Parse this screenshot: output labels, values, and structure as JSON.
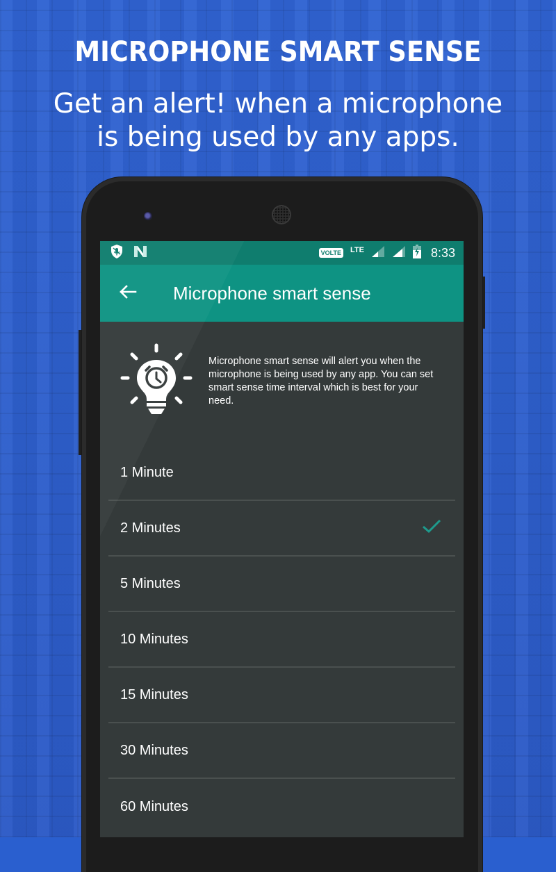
{
  "promo": {
    "title": "MICROPHONE SMART SENSE",
    "subtitle_line1": "Get an alert! when a microphone",
    "subtitle_line2": "is being used by any apps."
  },
  "status_bar": {
    "left_icons": [
      "shield-mic-icon",
      "n-logo-icon"
    ],
    "volte": "VOLTE",
    "network": "LTE",
    "time": "8:33"
  },
  "app_bar": {
    "back_icon": "arrow-left",
    "title": "Microphone smart sense"
  },
  "intro": {
    "icon": "lightbulb-clock-icon",
    "text": "Microphone smart sense will alert you when the microphone is being used by any app. You can set smart sense time interval which is best for your need."
  },
  "intervals": {
    "selected": "2 Minutes",
    "accent_color": "#1e9a8c",
    "items": [
      {
        "label": "1 Minute",
        "checked": false
      },
      {
        "label": "2 Minutes",
        "checked": true
      },
      {
        "label": "5 Minutes",
        "checked": false
      },
      {
        "label": "10 Minutes",
        "checked": false
      },
      {
        "label": "15 Minutes",
        "checked": false
      },
      {
        "label": "30 Minutes",
        "checked": false
      },
      {
        "label": "60 Minutes",
        "checked": false
      }
    ]
  },
  "colors": {
    "status_bar": "#0f7d6e",
    "app_bar": "#0e9383",
    "screen_bg": "#343a3a",
    "page_bg": "#2e5fcc"
  }
}
